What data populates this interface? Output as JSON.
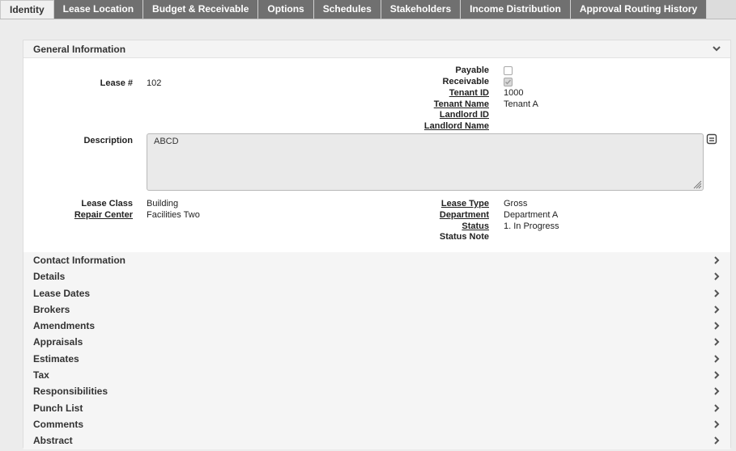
{
  "tabs": [
    {
      "label": "Identity",
      "active": true
    },
    {
      "label": "Lease Location"
    },
    {
      "label": "Budget & Receivable"
    },
    {
      "label": "Options"
    },
    {
      "label": "Schedules"
    },
    {
      "label": "Stakeholders"
    },
    {
      "label": "Income Distribution"
    },
    {
      "label": "Approval Routing History"
    }
  ],
  "general": {
    "title": "General Information",
    "lease_no_label": "Lease #",
    "lease_no_value": "102",
    "payable_label": "Payable",
    "payable_checked": false,
    "receivable_label": "Receivable",
    "receivable_checked": true,
    "tenant_id_label": "Tenant ID",
    "tenant_id_value": "1000",
    "tenant_name_label": "Tenant Name",
    "tenant_name_value": "Tenant A",
    "landlord_id_label": "Landlord ID",
    "landlord_name_label": "Landlord Name",
    "description_label": "Description",
    "description_value": "ABCD",
    "lease_class_label": "Lease Class",
    "lease_class_value": "Building",
    "repair_center_label": "Repair Center",
    "repair_center_value": "Facilities Two",
    "lease_type_label": "Lease Type",
    "lease_type_value": "Gross",
    "department_label": "Department",
    "department_value": "Department A",
    "status_label": "Status",
    "status_value": "1. In Progress",
    "status_note_label": "Status Note"
  },
  "sections": [
    "Contact Information",
    "Details",
    "Lease Dates",
    "Brokers",
    "Amendments",
    "Appraisals",
    "Estimates",
    "Tax",
    "Responsibilities",
    "Punch List",
    "Comments",
    "Abstract"
  ],
  "icons": {
    "collapse": "chevron-down-icon",
    "expand": "chevron-right-icon",
    "memo": "memo-icon",
    "resize": "resize-grip-icon"
  },
  "colors": {
    "tab_bg": "#707070",
    "tab_active_bg": "#f0f0f0",
    "page_bg": "#ececec",
    "section_bg": "#f5f5f5"
  }
}
